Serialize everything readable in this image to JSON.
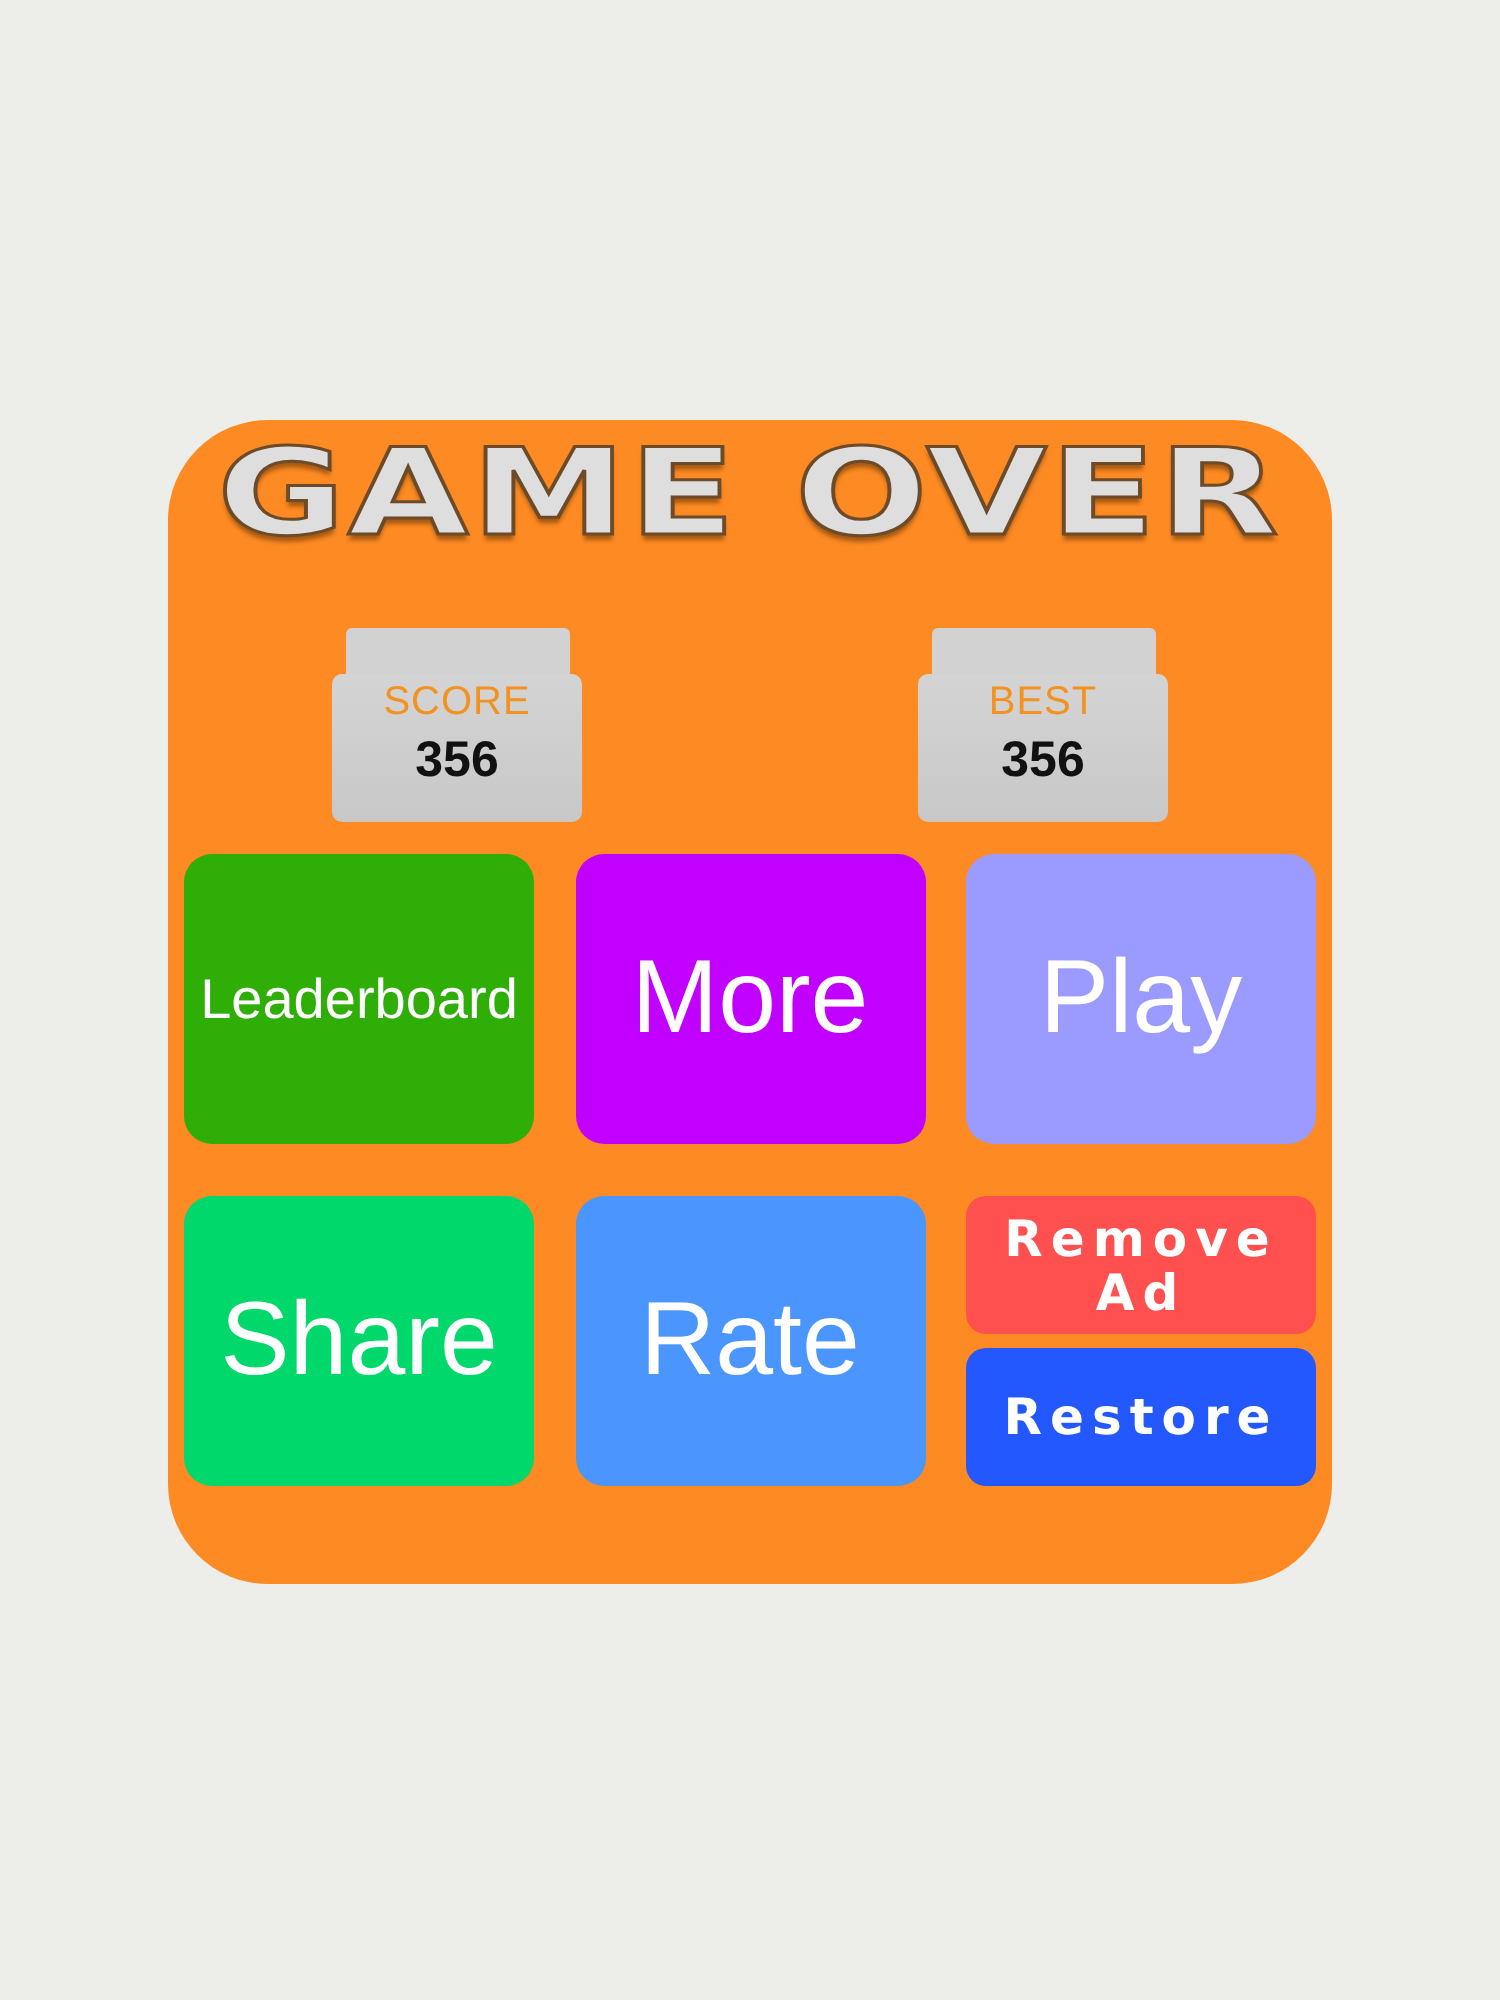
{
  "title": "GAME OVER",
  "stats": [
    {
      "label": "SCORE",
      "value": "356"
    },
    {
      "label": "BEST",
      "value": "356"
    }
  ],
  "buttons": [
    {
      "label": "Leaderboard",
      "kind": "tile",
      "color": "#2fae08"
    },
    {
      "label": "More",
      "kind": "tile",
      "color": "#c200ff"
    },
    {
      "label": "Play",
      "kind": "tile",
      "color": "#9b9bff"
    },
    {
      "label": "Share",
      "kind": "tile",
      "color": "#00d86c"
    },
    {
      "label": "Rate",
      "kind": "tile",
      "color": "#4b95ff"
    },
    {
      "label": "Remove Ad",
      "kind": "half",
      "color": "#ff5050"
    },
    {
      "label": "Restore",
      "kind": "half",
      "color": "#2458ff"
    }
  ]
}
